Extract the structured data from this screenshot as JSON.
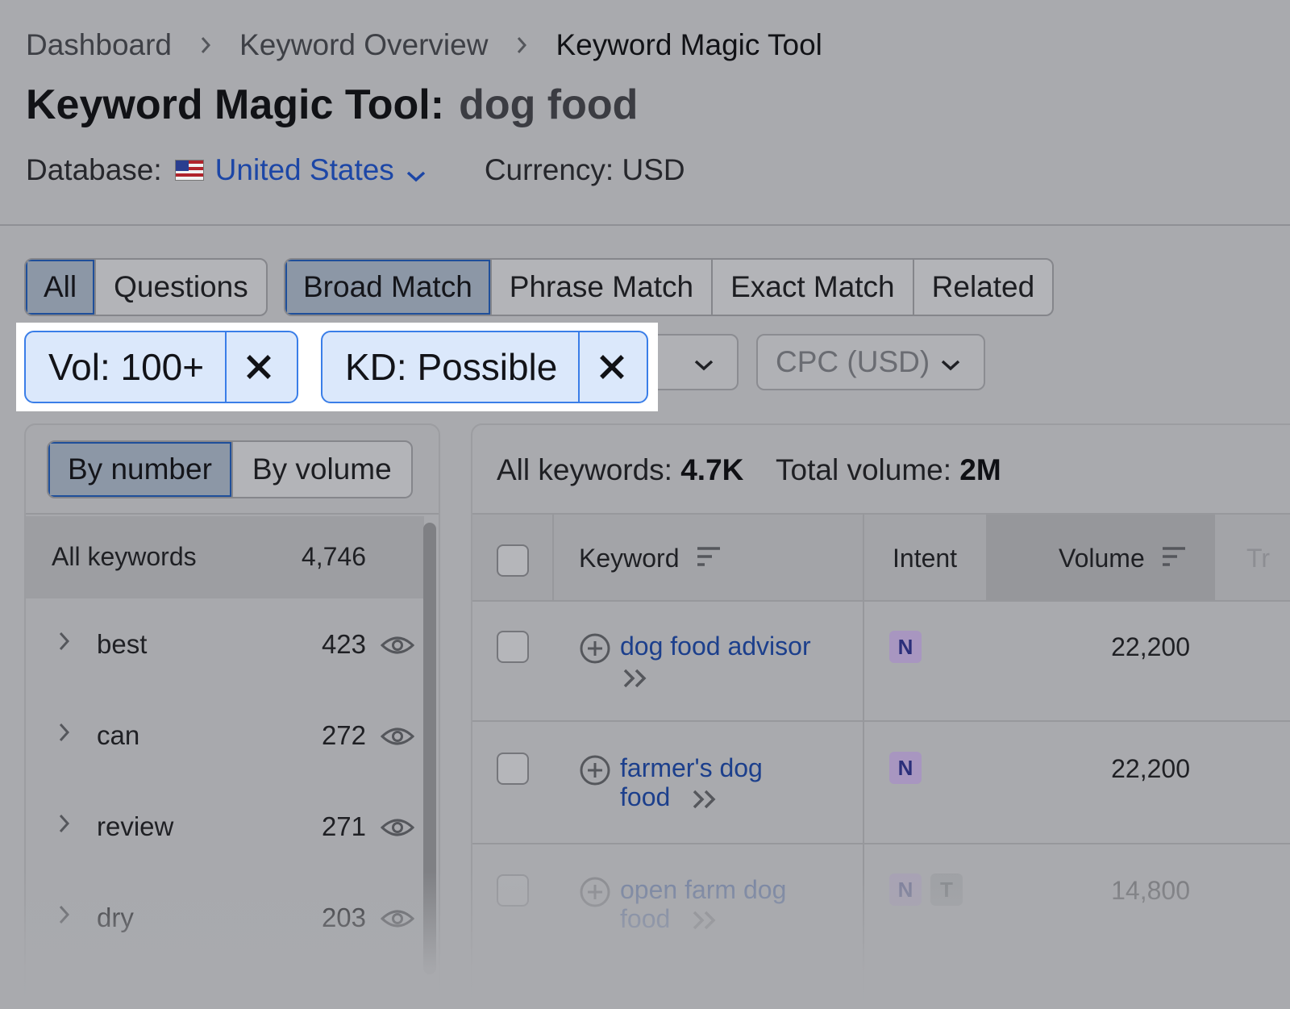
{
  "breadcrumb": [
    "Dashboard",
    "Keyword Overview",
    "Keyword Magic Tool"
  ],
  "title": {
    "tool": "Keyword Magic Tool:",
    "query": "dog food"
  },
  "database": {
    "label": "Database:",
    "value": "United States",
    "currency": "Currency: USD"
  },
  "tabs_primary": [
    "All",
    "Questions"
  ],
  "tabs_match": [
    "Broad Match",
    "Phrase Match",
    "Exact Match",
    "Related"
  ],
  "filters": {
    "chips": [
      "Vol: 100+",
      "KD: Possible"
    ],
    "cpc_label": "CPC (USD)"
  },
  "groups": {
    "toggle": [
      "By number",
      "By volume"
    ],
    "all_label": "All keywords",
    "all_count": "4,746",
    "items": [
      {
        "word": "best",
        "count": "423"
      },
      {
        "word": "can",
        "count": "272"
      },
      {
        "word": "review",
        "count": "271"
      },
      {
        "word": "dry",
        "count": "203"
      }
    ]
  },
  "summary": {
    "all_label": "All keywords:",
    "all_value": "4.7K",
    "total_label": "Total volume:",
    "total_value": "2M"
  },
  "table": {
    "headers": {
      "keyword": "Keyword",
      "intent": "Intent",
      "volume": "Volume",
      "trend_partial": "Tr"
    },
    "rows": [
      {
        "keyword_line1": "dog food advisor",
        "keyword_line2": "",
        "intents": [
          "N"
        ],
        "volume": "22,200"
      },
      {
        "keyword_line1": "farmer's dog",
        "keyword_line2": "food",
        "intents": [
          "N"
        ],
        "volume": "22,200"
      },
      {
        "keyword_line1": "open farm dog",
        "keyword_line2": "food",
        "intents": [
          "N",
          "T"
        ],
        "volume": "14,800"
      }
    ]
  },
  "colors": {
    "link": "#1c46a6",
    "chip_border": "#3a7ee8",
    "chip_bg": "#dbe8fb",
    "overlay": "#a9aaae"
  }
}
